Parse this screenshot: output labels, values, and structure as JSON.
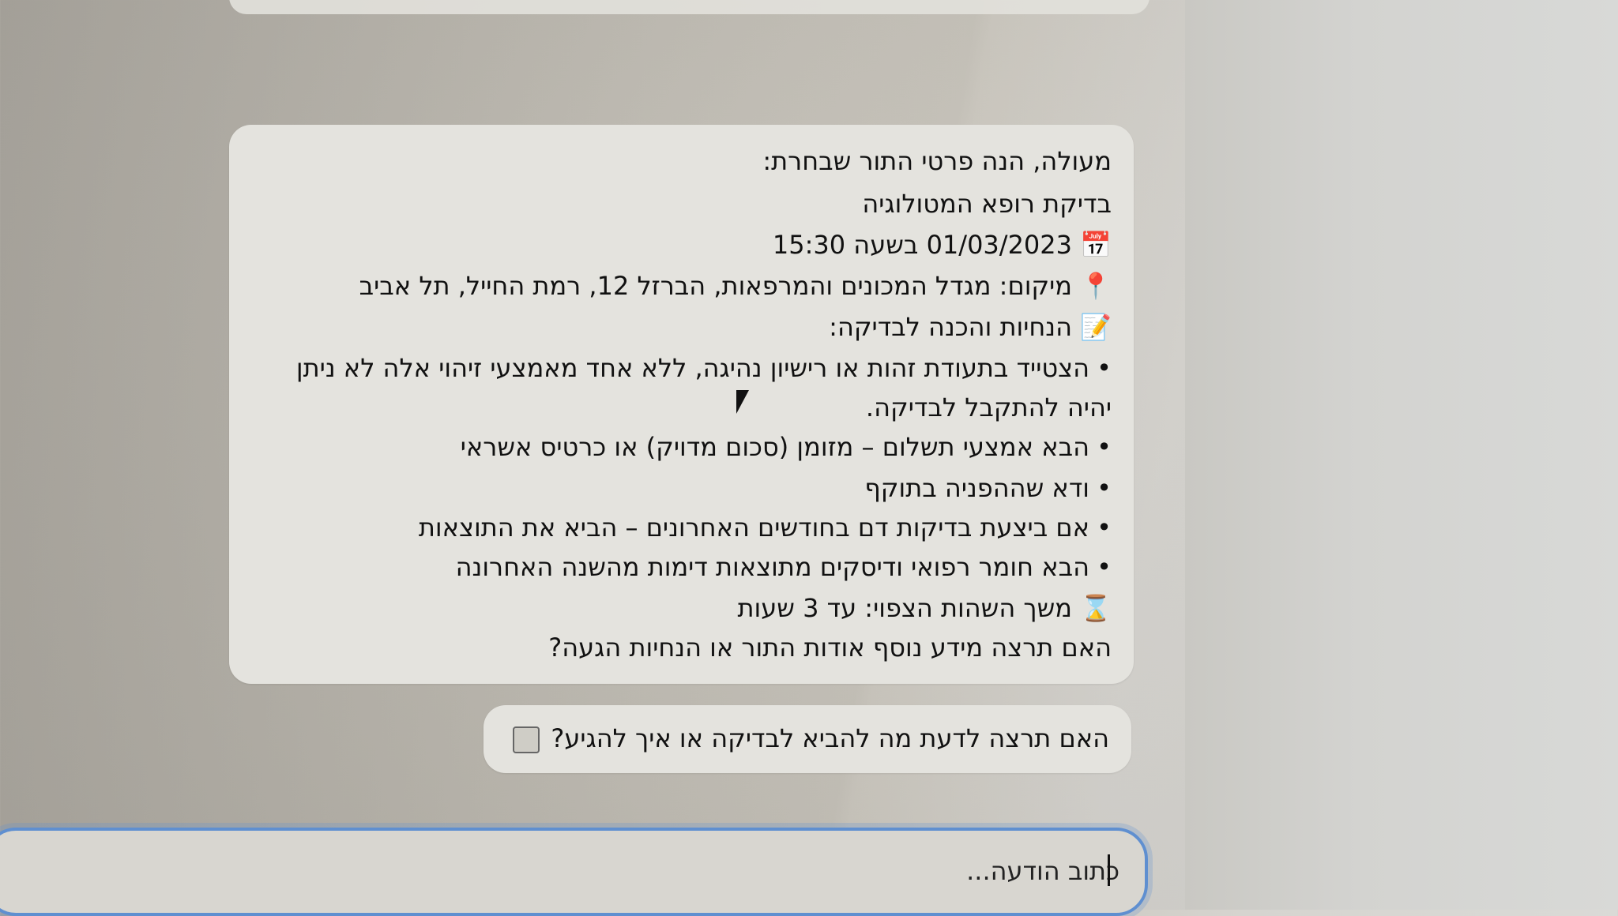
{
  "chat": {
    "assistant_message": {
      "intro": "מעולה, הנה פרטי התור שבחרת:",
      "test_name": "בדיקת רופא המטולוגיה",
      "datetime": {
        "icon": "calendar-icon",
        "glyph": "📅",
        "text": "01/03/2023 בשעה 15:30"
      },
      "location": {
        "icon": "pin-icon",
        "glyph": "📍",
        "text": "מיקום: מגדל המכונים והמרפאות, הברזל 12, רמת החייל, תל אביב"
      },
      "instructions_header": {
        "icon": "memo-icon",
        "glyph": "📝",
        "text": "הנחיות והכנה לבדיקה:"
      },
      "bullets": [
        "הצטייד בתעודת זהות או רישיון נהיגה, ללא אחד מאמצעי זיהוי אלה לא ניתן",
        "הבא אמצעי תשלום – מזומן (סכום מדויק) או כרטיס אשראי",
        "ודא שההפניה בתוקף",
        "אם ביצעת בדיקות דם בחודשים האחרונים – הביא את התוצאות",
        "הבא חומר רפואי ודיסקים מתוצאות דימות מהשנה האחרונה"
      ],
      "bullet_continuation": "יהיה להתקבל לבדיקה.",
      "duration": {
        "icon": "hourglass-icon",
        "glyph": "⌛",
        "text": "משך השהות הצפוי: עד 3 שעות"
      },
      "closing_question": "האם תרצה מידע נוסף אודות התור או הנחיות הגעה?"
    },
    "followup_suggestion": {
      "text": "האם תרצה לדעת מה להביא לבדיקה או איך להגיע?",
      "icon": "checkbox-icon"
    }
  },
  "composer": {
    "placeholder": "כתוב הודעה..."
  },
  "colors": {
    "bubble": "#e4e3de",
    "input_border": "#5f8fd0"
  }
}
